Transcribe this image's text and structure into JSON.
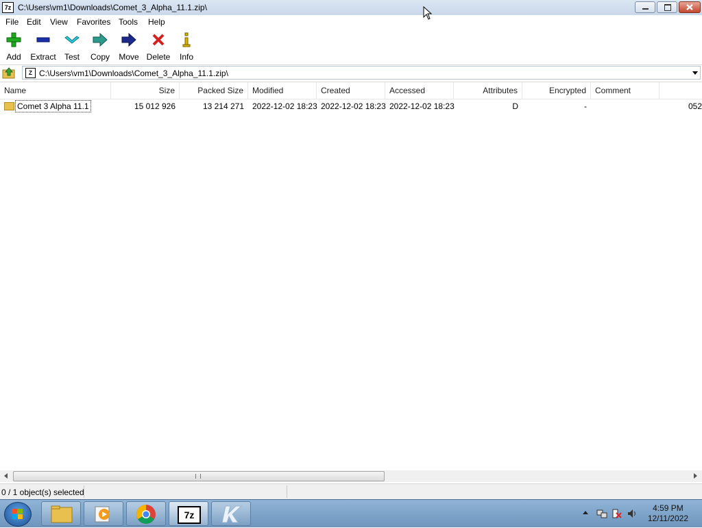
{
  "window": {
    "title": "C:\\Users\\vm1\\Downloads\\Comet_3_Alpha_11.1.zip\\",
    "app_icon": "7z"
  },
  "menu": [
    "File",
    "Edit",
    "View",
    "Favorites",
    "Tools",
    "Help"
  ],
  "toolbar": [
    {
      "label": "Add",
      "icon": "plus-icon"
    },
    {
      "label": "Extract",
      "icon": "minus-icon"
    },
    {
      "label": "Test",
      "icon": "check-icon"
    },
    {
      "label": "Copy",
      "icon": "copy-arrow-icon"
    },
    {
      "label": "Move",
      "icon": "move-arrow-icon"
    },
    {
      "label": "Delete",
      "icon": "delete-x-icon"
    },
    {
      "label": "Info",
      "icon": "info-icon"
    }
  ],
  "address": {
    "path": "C:\\Users\\vm1\\Downloads\\Comet_3_Alpha_11.1.zip\\",
    "icon_text": "Z"
  },
  "columns": [
    "Name",
    "Size",
    "Packed Size",
    "Modified",
    "Created",
    "Accessed",
    "Attributes",
    "Encrypted",
    "Comment"
  ],
  "rows": [
    {
      "name": "Comet 3 Alpha 11.1",
      "size": "15 012 926",
      "packed_size": "13 214 271",
      "modified": "2022-12-02 18:23",
      "created": "2022-12-02 18:23",
      "accessed": "2022-12-02 18:23",
      "attributes": "D",
      "encrypted": "-",
      "comment": "",
      "overflow": "052"
    }
  ],
  "status": {
    "selection": "0 / 1 object(s) selected"
  },
  "taskbar": {
    "time": "4:59 PM",
    "date": "12/11/2022",
    "start_label": "7z"
  },
  "colors": {
    "accent_folder": "#e7c04f",
    "titlebar": "#dbe6f3",
    "taskbar": "#7fa5cb"
  }
}
